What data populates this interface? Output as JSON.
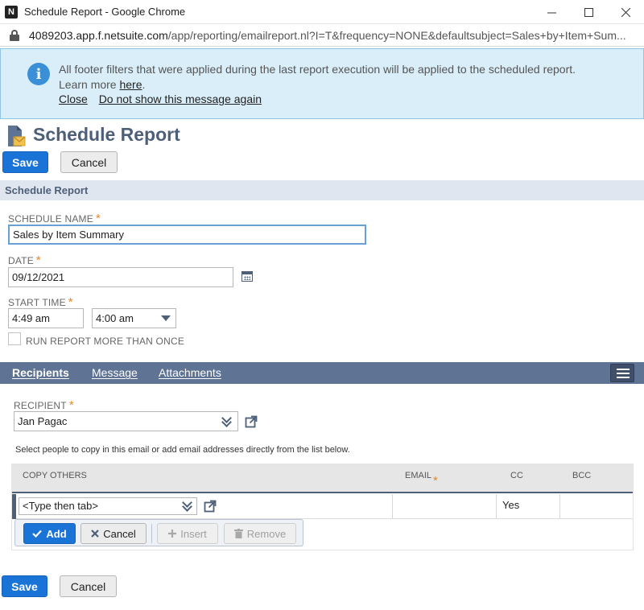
{
  "window": {
    "title": "Schedule Report - Google Chrome",
    "app_icon_letter": "N",
    "url_host": "4089203.app.f.netsuite.com",
    "url_path": "/app/reporting/emailreport.nl?I=T&frequency=NONE&defaultsubject=Sales+by+Item+Sum..."
  },
  "banner": {
    "message": "All footer filters that were applied during the last report execution will be applied to the scheduled report.",
    "learn_more_prefix": "Learn more",
    "learn_more_link": "here",
    "close_link": "Close",
    "dismiss_link": "Do not show this message again"
  },
  "page": {
    "title": "Schedule Report",
    "save_label": "Save",
    "cancel_label": "Cancel"
  },
  "section": {
    "title": "Schedule Report"
  },
  "form": {
    "schedule_name_label": "SCHEDULE NAME",
    "schedule_name_value": "Sales by Item Summary",
    "date_label": "DATE",
    "date_value": "09/12/2021",
    "start_time_label": "START TIME",
    "start_time_value": "4:49 am",
    "start_time_select": "4:00 am",
    "run_more_label": "RUN REPORT MORE THAN ONCE",
    "required_marker": "*"
  },
  "tabs": [
    {
      "label": "Recipients",
      "active": true
    },
    {
      "label": "Message",
      "active": false
    },
    {
      "label": "Attachments",
      "active": false
    }
  ],
  "recipients": {
    "recipient_label": "RECIPIENT",
    "recipient_value": "Jan Pagac",
    "hint": "Select people to copy in this email or add email addresses directly from the list below.",
    "columns": {
      "copy_others": "COPY OTHERS",
      "email": "EMAIL",
      "cc": "CC",
      "bcc": "BCC"
    },
    "row": {
      "copy_others_placeholder": "<Type then tab>",
      "cc": "Yes",
      "bcc": ""
    },
    "actions": {
      "add": "Add",
      "cancel": "Cancel",
      "insert": "Insert",
      "remove": "Remove"
    }
  },
  "colors": {
    "primary": "#1a74d8",
    "header_text": "#4d5f79",
    "tab_bar": "#5f7394",
    "banner_bg": "#d9eef8",
    "required": "#e0892b"
  }
}
